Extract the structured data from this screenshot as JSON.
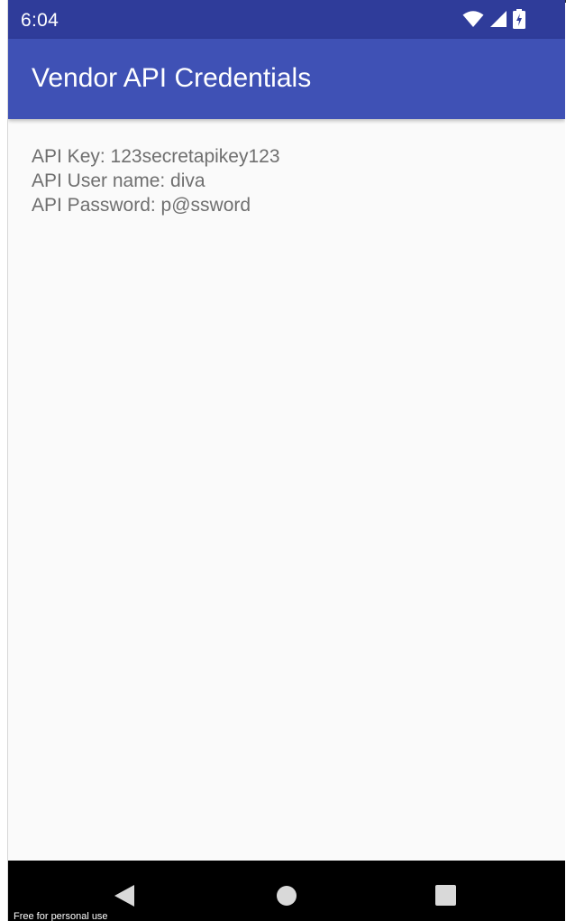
{
  "status_bar": {
    "time": "6:04",
    "icons": [
      "wifi-icon",
      "cell-signal-icon",
      "battery-charging-icon"
    ],
    "color": "#2f3c9a"
  },
  "app_bar": {
    "title": "Vendor API Credentials",
    "color": "#3f51b5"
  },
  "credentials": {
    "api_key": "API Key: 123secretapikey123",
    "api_user": "API User name: diva",
    "api_password": "API Password: p@ssword"
  },
  "nav_bar": {
    "buttons": [
      "back-icon",
      "home-icon",
      "recents-icon"
    ]
  },
  "watermark": "Free for personal use"
}
